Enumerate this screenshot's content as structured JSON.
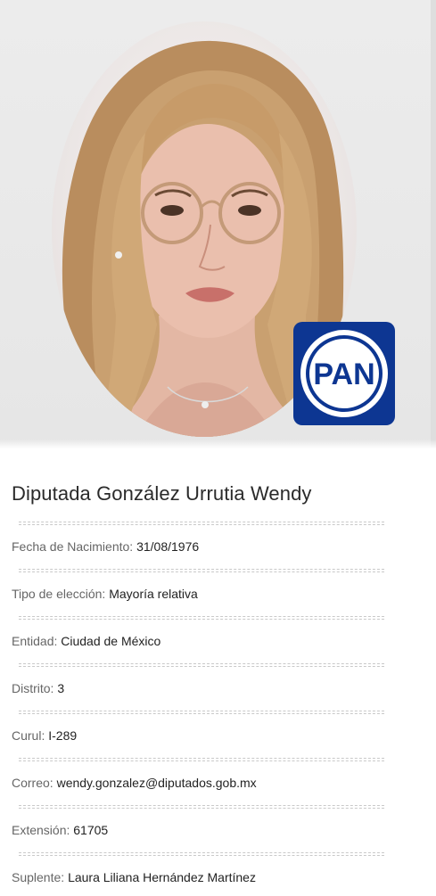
{
  "profile": {
    "title": "Diputada González Urrutia Wendy",
    "party_logo_text": "PAN",
    "party_color": "#0d3692"
  },
  "fields": [
    {
      "label": "Fecha de Nacimiento:",
      "value": "31/08/1976"
    },
    {
      "label": "Tipo de elección:",
      "value": "Mayoría relativa"
    },
    {
      "label": "Entidad:",
      "value": "Ciudad de México"
    },
    {
      "label": "Distrito:",
      "value": "3"
    },
    {
      "label": "Curul:",
      "value": "I-289"
    },
    {
      "label": "Correo:",
      "value": "wendy.gonzalez@diputados.gob.mx"
    },
    {
      "label": "Extensión:",
      "value": "61705"
    },
    {
      "label": "Suplente:",
      "value": "Laura Liliana Hernández Martínez"
    }
  ]
}
